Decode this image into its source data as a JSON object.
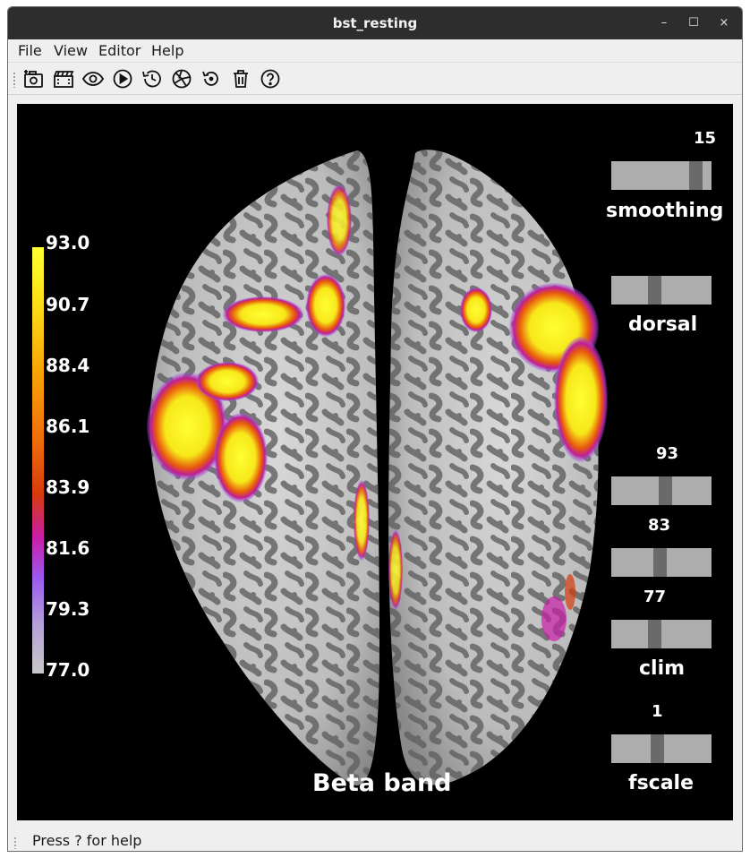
{
  "window": {
    "title": "bst_resting",
    "controls": {
      "minimize": "–",
      "maximize": "☐",
      "close": "×"
    }
  },
  "menubar": {
    "items": [
      {
        "label": "File"
      },
      {
        "label": "View"
      },
      {
        "label": "Editor"
      },
      {
        "label": "Help"
      }
    ]
  },
  "toolbar": {
    "tools": [
      {
        "icon": "screenshot-camera-icon"
      },
      {
        "icon": "movie-clapper-icon"
      },
      {
        "icon": "eye-icon"
      },
      {
        "icon": "play-icon"
      },
      {
        "icon": "history-clock-icon"
      },
      {
        "icon": "aperture-icon"
      },
      {
        "icon": "reset-icon"
      },
      {
        "icon": "trash-icon"
      },
      {
        "icon": "help-icon"
      }
    ]
  },
  "colorbar": {
    "labels": [
      "93.0",
      "90.7",
      "88.4",
      "86.1",
      "83.9",
      "81.6",
      "79.3",
      "77.0"
    ],
    "min": 77.0,
    "max": 93.0
  },
  "sliders": {
    "smoothing": {
      "name": "smoothing",
      "value": "15",
      "level": 0.9
    },
    "dorsal": {
      "name": "dorsal",
      "value": "",
      "level": 0.42
    },
    "clim_max": {
      "value": "93",
      "level": 0.55
    },
    "clim_mid": {
      "value": "83",
      "level": 0.48
    },
    "clim_min": {
      "value": "77",
      "level": 0.42
    },
    "clim": {
      "name": "clim"
    },
    "fscale": {
      "name": "fscale",
      "value": "1",
      "level": 0.45
    }
  },
  "viewport": {
    "label": "Beta band"
  },
  "statusbar": {
    "text": "Press ? for help"
  },
  "colors": {
    "titlebar": "#2d2d2d",
    "viewport_bg": "#000000",
    "slider_track": "#adadad",
    "slider_handle": "#6a6a6a"
  }
}
